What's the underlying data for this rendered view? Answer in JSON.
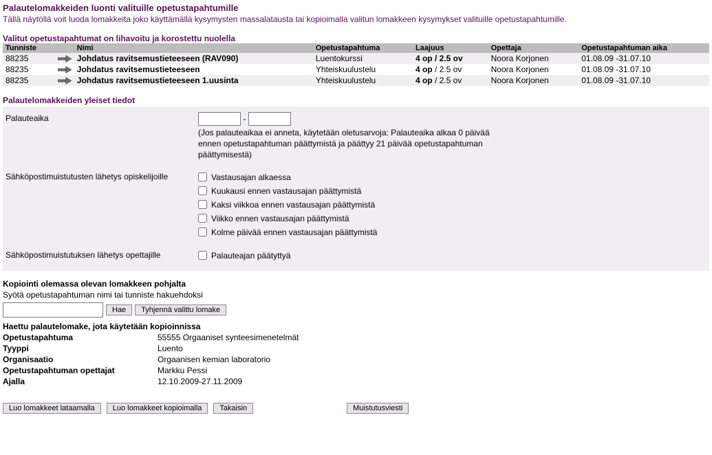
{
  "page": {
    "title": "Palautelomakkeiden luonti valituille opetustapahtumille",
    "desc": "Tällä näytöllä voit luoda lomakkeita joko käyttämällä kysymysten massalatausta tai kopioimalla valitun lomakkeen kysymykset valituille opetustapahtumille."
  },
  "events": {
    "heading": "Valitut opetustapahtumat on lihavoitu ja korostettu nuolella",
    "cols": {
      "tunniste": "Tunniste",
      "nimi": "Nimi",
      "opetustapahtuma": "Opetustapahtuma",
      "laajuus": "Laajuus",
      "opettaja": "Opettaja",
      "aika": "Opetustapahtuman aika"
    },
    "rows": [
      {
        "tunniste": "88235",
        "nimi": "Johdatus ravitsemustieteeseen (RAV090)",
        "tapahtuma": "Luentokurssi",
        "laajuus_bold": "4 op / 2.5 ov",
        "laajuus_plain": "",
        "opettaja": "Noora Korjonen",
        "aika": "01.08.09 -31.07.10",
        "bold_name": true,
        "bold_all_laajuus": true
      },
      {
        "tunniste": "88235",
        "nimi": "Johdatus ravitsemustieteeseen",
        "tapahtuma": "Yhteiskuulustelu",
        "laajuus_bold": "4 op",
        "laajuus_plain": " / 2.5 ov",
        "opettaja": "Noora Korjonen",
        "aika": "01.08.09 -31.07.10",
        "bold_name": true,
        "bold_all_laajuus": false
      },
      {
        "tunniste": "88235",
        "nimi": "Johdatus ravitsemustieteeseen 1.uusinta",
        "tapahtuma": "Yhteiskuulustelu",
        "laajuus_bold": "4 op",
        "laajuus_plain": " / 2.5 ov",
        "opettaja": "Noora Korjonen",
        "aika": "01.08.09 -31.07.10",
        "bold_name": true,
        "bold_all_laajuus": false
      }
    ]
  },
  "form": {
    "heading": "Palautelomakkeiden yleiset tiedot",
    "palauteaika_label": "Palauteaika",
    "date_sep": "-",
    "palauteaika_hint": "(Jos palauteaikaa ei anneta, käytetään oletusarvoja: Palauteaika alkaa 0 päivää ennen opetustapahtuman päättymistä ja päättyy 21 päivää opetustapahtuman päättymisestä)",
    "reminder_students_label": "Sähköpostimuistutusten lähetys opiskelijoille",
    "reminder_options": [
      "Vastausajan alkaessa",
      "Kuukausi ennen vastausajan päättymistä",
      "Kaksi viikkoa ennen vastausajan päättymistä",
      "Viikko ennen vastausajan päättymistä",
      "Kolme päivää ennen vastausajan päättymistä"
    ],
    "reminder_teachers_label": "Sähköpostimuistutuksen lähetys opettajille",
    "reminder_teacher_option": "Palauteajan päätyttyä"
  },
  "copy": {
    "heading": "Kopiointi olemassa olevan lomakkeen pohjalta",
    "search_label": "Syötä opetustapahtuman nimi tai tunniste hakuehdoksi",
    "hae": "Hae",
    "tyhjenna": "Tyhjennä valittu lomake",
    "fetched_heading": "Haettu palautelomake, jota käytetään kopioinnissa",
    "details": {
      "opetustapahtuma_k": "Opetustapahtuma",
      "opetustapahtuma_v": "55555 Orgaaniset synteesimenetelmät",
      "tyyppi_k": "Tyyppi",
      "tyyppi_v": "Luento",
      "organisaatio_k": "Organisaatio",
      "organisaatio_v": "Orgaanisen kemian laboratorio",
      "opettajat_k": "Opetustapahtuman opettajat",
      "opettajat_v": "Markku Pessi",
      "ajalla_k": "Ajalla",
      "ajalla_v": "12.10.2009-27.11.2009"
    }
  },
  "buttons": {
    "luo_lataamalla": "Luo lomakkeet lataamalla",
    "luo_kopioimalla": "Luo lomakkeet kopioimalla",
    "takaisin": "Takaisin",
    "muistutus": "Muistutusviesti"
  }
}
